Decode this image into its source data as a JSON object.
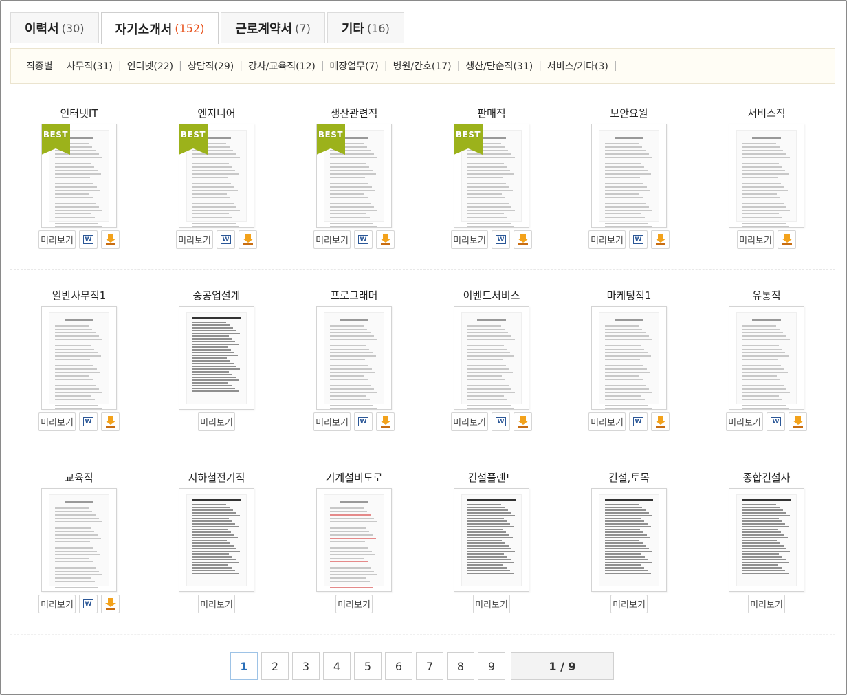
{
  "tabs": [
    {
      "label": "이력서",
      "count": "(30)",
      "active": false
    },
    {
      "label": "자기소개서",
      "count": "(152)",
      "active": true
    },
    {
      "label": "근로계약서",
      "count": "(7)",
      "active": false
    },
    {
      "label": "기타",
      "count": "(16)",
      "active": false
    }
  ],
  "filter": {
    "label": "직종별",
    "items": [
      "사무직(31)",
      "인터넷(22)",
      "상담직(29)",
      "강사/교육직(12)",
      "매장업무(7)",
      "병원/간호(17)",
      "생산/단순직(31)",
      "서비스/기타(3)"
    ]
  },
  "buttons": {
    "preview": "미리보기",
    "best_badge": "BEST",
    "word_glyph": "W"
  },
  "items": [
    {
      "title": "인터넷IT",
      "best": true,
      "word": true,
      "download": true,
      "style": "light"
    },
    {
      "title": "엔지니어",
      "best": true,
      "word": true,
      "download": true,
      "style": "light"
    },
    {
      "title": "생산관련직",
      "best": true,
      "word": true,
      "download": true,
      "style": "light"
    },
    {
      "title": "판매직",
      "best": true,
      "word": true,
      "download": true,
      "style": "light"
    },
    {
      "title": "보안요원",
      "best": false,
      "word": true,
      "download": true,
      "style": "light"
    },
    {
      "title": "서비스직",
      "best": false,
      "word": false,
      "download": true,
      "style": "light"
    },
    {
      "title": "일반사무직1",
      "best": false,
      "word": true,
      "download": true,
      "style": "light"
    },
    {
      "title": "중공업설계",
      "best": false,
      "word": false,
      "download": false,
      "style": "dense"
    },
    {
      "title": "프로그래머",
      "best": false,
      "word": true,
      "download": true,
      "style": "light"
    },
    {
      "title": "이벤트서비스",
      "best": false,
      "word": true,
      "download": true,
      "style": "light"
    },
    {
      "title": "마케팅직1",
      "best": false,
      "word": true,
      "download": true,
      "style": "light"
    },
    {
      "title": "유통직",
      "best": false,
      "word": true,
      "download": true,
      "style": "light"
    },
    {
      "title": "교육직",
      "best": false,
      "word": true,
      "download": true,
      "style": "light"
    },
    {
      "title": "지하철전기직",
      "best": false,
      "word": false,
      "download": false,
      "style": "dense"
    },
    {
      "title": "기계설비도로",
      "best": false,
      "word": false,
      "download": false,
      "style": "red"
    },
    {
      "title": "건설플랜트",
      "best": false,
      "word": false,
      "download": false,
      "style": "dense"
    },
    {
      "title": "건설,토목",
      "best": false,
      "word": false,
      "download": false,
      "style": "dense"
    },
    {
      "title": "종합건설사",
      "best": false,
      "word": false,
      "download": false,
      "style": "dense"
    }
  ],
  "pagination": {
    "pages": [
      "1",
      "2",
      "3",
      "4",
      "5",
      "6",
      "7",
      "8",
      "9"
    ],
    "current": "1",
    "total_label": "1 / 9"
  },
  "colors": {
    "accent_count": "#e8541f",
    "best_ribbon": "#9cb21b",
    "word_blue": "#2b5797",
    "download_orange": "#f3a21b"
  }
}
